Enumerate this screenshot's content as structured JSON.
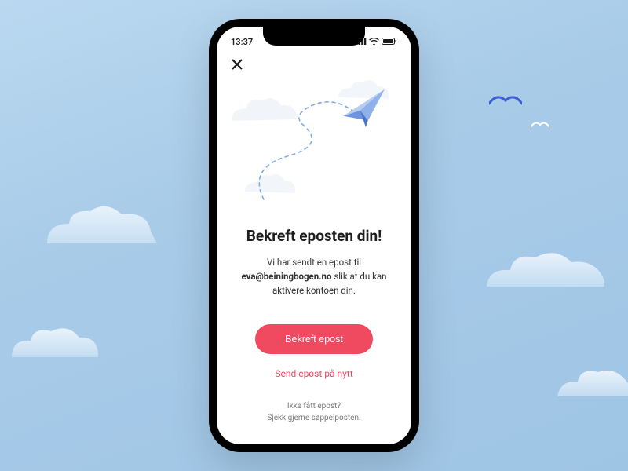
{
  "status_bar": {
    "time": "13:37"
  },
  "screen": {
    "title": "Bekreft eposten din!",
    "description_prefix": "Vi har sendt en epost til ",
    "description_email": "eva@beiningbogen.no",
    "description_suffix": " slik at du kan aktivere kontoen din.",
    "primary_button": "Bekreft epost",
    "secondary_link": "Send epost på nytt",
    "help_line1": "Ikke fått epost?",
    "help_line2": "Sjekk gjerne søppelposten."
  },
  "colors": {
    "accent": "#ef4a5f"
  }
}
